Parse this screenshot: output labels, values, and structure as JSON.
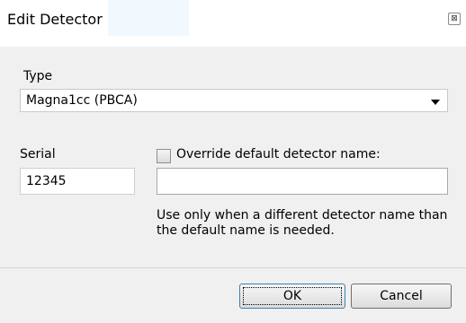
{
  "window": {
    "title": "Edit Detector",
    "close_glyph": "⊠"
  },
  "type_field": {
    "label": "Type",
    "selected": "Magna1cc (PBCA)"
  },
  "serial_field": {
    "label": "Serial",
    "value": "12345"
  },
  "override": {
    "checkbox_label": "Override default detector name:",
    "checked": false,
    "value": "",
    "hint": "Use only when a different detector name than the default name is needed."
  },
  "buttons": {
    "ok": "OK",
    "cancel": "Cancel"
  },
  "colors": {
    "dialog_bg": "#f0f0f0",
    "titlebar_bg": "#ffffff",
    "default_button_border": "#3c7fb1"
  },
  "icons": [
    "close-icon",
    "dropdown-arrow-icon"
  ]
}
